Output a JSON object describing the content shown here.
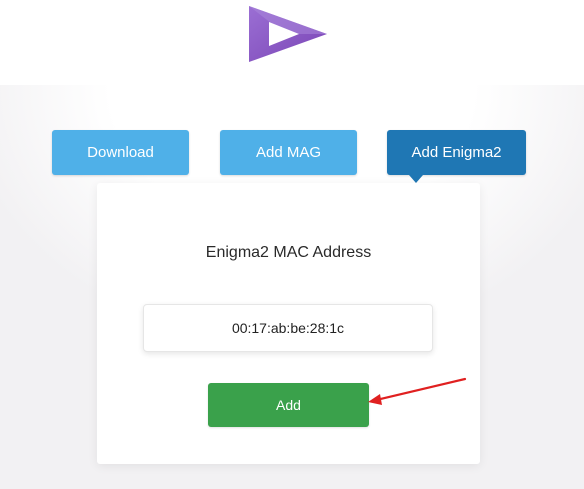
{
  "tabs": [
    {
      "label": "Download",
      "active": false
    },
    {
      "label": "Add MAG",
      "active": false
    },
    {
      "label": "Add Enigma2",
      "active": true
    }
  ],
  "form": {
    "title": "Enigma2 MAC Address",
    "mac_value": "00:17:ab:be:28:1c",
    "submit_label": "Add"
  },
  "colors": {
    "tab_inactive": "#4fb0e8",
    "tab_active": "#1f77b4",
    "submit": "#3aa14b",
    "logo": "#8e5cc5",
    "annotation_arrow": "#e02020"
  },
  "icons": {
    "logo": "play-logo-icon",
    "annotation": "red-arrow-icon"
  }
}
